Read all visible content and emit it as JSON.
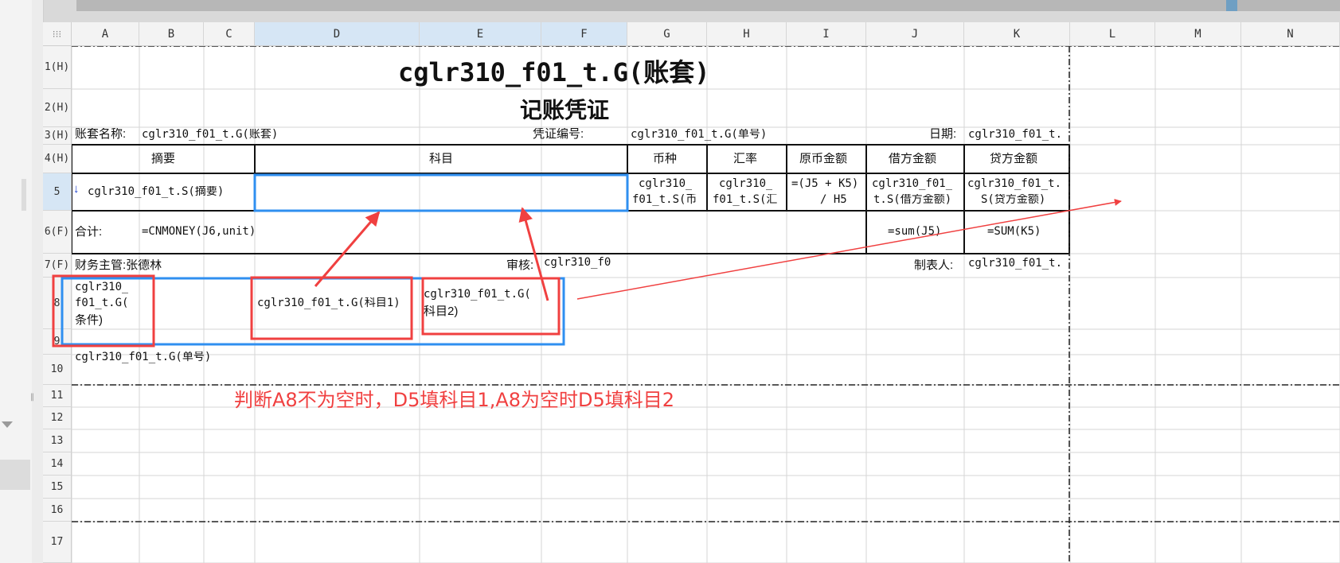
{
  "columns": [
    "A",
    "B",
    "C",
    "D",
    "E",
    "F",
    "G",
    "H",
    "I",
    "J",
    "K",
    "L",
    "M",
    "N"
  ],
  "rows": [
    "1(H)",
    "2(H)",
    "3(H)",
    "4(H)",
    "5",
    "6(F)",
    "7(F)",
    "8",
    "9",
    "10",
    "11",
    "12",
    "13",
    "14",
    "15",
    "16",
    "17"
  ],
  "corner_glyph": "⁝⁝⁝",
  "grip_glyph": "‖",
  "cells": {
    "title": "cglr310_f01_t.G(账套)",
    "subtitle": "记账凭证",
    "r3_label_account": "账套名称:",
    "r3_value_account": "cglr310_f01_t.G(账套)",
    "r3_label_voucher": "凭证编号:",
    "r3_value_voucher": "cglr310_f01_t.G(单号)",
    "r3_label_date": "日期:",
    "r3_value_date": "cglr310_f01_t.",
    "h_summary": "摘要",
    "h_subject": "科目",
    "h_currency": "币种",
    "h_rate": "汇率",
    "h_orig": "原币金额",
    "h_debit": "借方金额",
    "h_credit": "贷方金额",
    "r5_summary": "cglr310_f01_t.S(摘要)",
    "r5_currency_1": "cglr310_",
    "r5_currency_2": "f01_t.S(币",
    "r5_rate_1": "cglr310_",
    "r5_rate_2": "f01_t.S(汇",
    "r5_orig_1": "=(J5 + K5)",
    "r5_orig_2": "/ H5",
    "r5_debit_1": "cglr310_f01_",
    "r5_debit_2": "t.S(借方金额)",
    "r5_credit_1": "cglr310_f01_t.",
    "r5_credit_2": "S(贷方金额)",
    "r6_total_label": "合计:",
    "r6_total_formula": "=CNMONEY(J6,unit)",
    "r6_sum_j": "=sum(J5)",
    "r6_sum_k": "=SUM(K5)",
    "r7_supervisor": "财务主管:张德林",
    "r7_audit_label": "审核:",
    "r7_audit_value": "cglr310_f0",
    "r7_maker_label": "制表人:",
    "r7_maker_value": "cglr310_f01_t.",
    "a8_line1": "cglr310_",
    "a8_line2": "f01_t.G(",
    "a8_line3": "条件)",
    "d8": "cglr310_f01_t.G(科目1)",
    "e8_line1": "cglr310_f01_t.G(",
    "e8_line2": "科目2)",
    "a9": "cglr310_f01_t.G(单号)"
  },
  "annotation": {
    "note": "判断A8不为空时，D5填科目1,A8为空时D5填科目2"
  },
  "colors": {
    "annotation_red": "#f04040",
    "selection_blue": "#2f8ff0",
    "header_bg": "#f3f3f3",
    "header_selected_bg": "#d6e6f5",
    "gridline": "#d6d6d6"
  }
}
